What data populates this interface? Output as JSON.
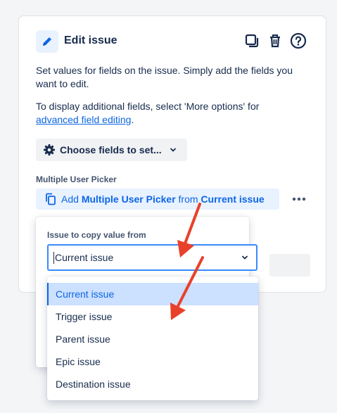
{
  "panel": {
    "title": "Edit issue",
    "description_line1": "Set values for fields on the issue. Simply add the fields you",
    "description_line2": "want to edit.",
    "hint_line1": "To display additional fields, select 'More options' for",
    "hint_link": "advanced field editing",
    "hint_end": ".",
    "choose_fields_label": "Choose fields to set...",
    "field_label": "Multiple User Picker",
    "add_prefix": "Add",
    "add_field": "Multiple User Picker",
    "add_middle": "from",
    "add_source": "Current issue"
  },
  "popup": {
    "label": "Issue to copy value from",
    "selected_value": "Current issue",
    "options": [
      "Current issue",
      "Trigger issue",
      "Parent issue",
      "Epic issue",
      "Destination issue"
    ]
  },
  "icons": {
    "header": "pencil-icon",
    "duplicate": "duplicate-icon",
    "delete": "trash-icon",
    "help": "help-icon"
  },
  "colors": {
    "accent": "#0c66e4",
    "selected_bg": "#cce0ff",
    "annotation_arrow": "#e8412b"
  }
}
